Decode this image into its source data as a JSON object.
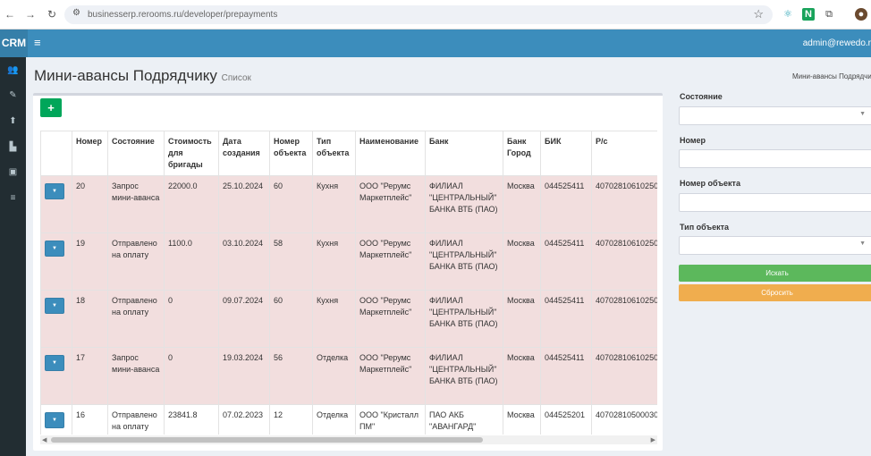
{
  "browser": {
    "url": "businesserp.rerooms.ru/developer/prepayments"
  },
  "header": {
    "logo": "CRM",
    "user": "admin@rewedo.r"
  },
  "page": {
    "title": "Мини-авансы Подрядчику",
    "subtitle": "Список",
    "breadcrumb": "Мини-авансы Подрядчи",
    "add_label": "+"
  },
  "table": {
    "headers": [
      "",
      "Номер",
      "Состояние",
      "Стоимость для бригады",
      "Дата создания",
      "Номер объекта",
      "Тип объекта",
      "Наименование",
      "Банк",
      "Банк Город",
      "БИК",
      "Р/с"
    ],
    "rows": [
      {
        "number": "20",
        "status": "Запрос мини-аванса",
        "cost": "22000.0",
        "date": "25.10.2024",
        "object": "60",
        "type": "Кухня",
        "name": "ООО \"Рерумс Маркетплейс\"",
        "bank": "ФИЛИАЛ \"ЦЕНТРАЛЬНЫЙ\" БАНКА ВТБ (ПАО)",
        "city": "Москва",
        "bik": "044525411",
        "account": "40702810610250"
      },
      {
        "number": "19",
        "status": "Отправлено на оплату",
        "cost": "1100.0",
        "date": "03.10.2024",
        "object": "58",
        "type": "Кухня",
        "name": "ООО \"Рерумс Маркетплейс\"",
        "bank": "ФИЛИАЛ \"ЦЕНТРАЛЬНЫЙ\" БАНКА ВТБ (ПАО)",
        "city": "Москва",
        "bik": "044525411",
        "account": "40702810610250"
      },
      {
        "number": "18",
        "status": "Отправлено на оплату",
        "cost": "0",
        "date": "09.07.2024",
        "object": "60",
        "type": "Кухня",
        "name": "ООО \"Рерумс Маркетплейс\"",
        "bank": "ФИЛИАЛ \"ЦЕНТРАЛЬНЫЙ\" БАНКА ВТБ (ПАО)",
        "city": "Москва",
        "bik": "044525411",
        "account": "40702810610250"
      },
      {
        "number": "17",
        "status": "Запрос мини-аванса",
        "cost": "0",
        "date": "19.03.2024",
        "object": "56",
        "type": "Отделка",
        "name": "ООО \"Рерумс Маркетплейс\"",
        "bank": "ФИЛИАЛ \"ЦЕНТРАЛЬНЫЙ\" БАНКА ВТБ (ПАО)",
        "city": "Москва",
        "bik": "044525411",
        "account": "40702810610250"
      },
      {
        "number": "16",
        "status": "Отправлено на оплату",
        "cost": "23841.8",
        "date": "07.02.2023",
        "object": "12",
        "type": "Отделка",
        "name": "ООО \"Кристалл ПМ\"",
        "bank": "ПАО АКБ \"АВАНГАРД\"",
        "city": "Москва",
        "bik": "044525201",
        "account": "40702810500030"
      }
    ]
  },
  "filter": {
    "status_label": "Состояние",
    "number_label": "Номер",
    "object_label": "Номер объекта",
    "type_label": "Тип объекта",
    "search_label": "Искать",
    "reset_label": "Сбросить"
  },
  "colors": {
    "header": "#3c8dbc",
    "sidebar": "#222d32",
    "row_highlight": "#f2dede",
    "search": "#5cb85c",
    "reset": "#f0ad4e",
    "add": "#00a65a"
  },
  "icons": {
    "back": "arrow-left-icon",
    "forward": "arrow-right-icon",
    "reload": "reload-icon",
    "star": "star-icon",
    "menu": "hamburger-icon",
    "dropdown": "caret-down-icon"
  }
}
